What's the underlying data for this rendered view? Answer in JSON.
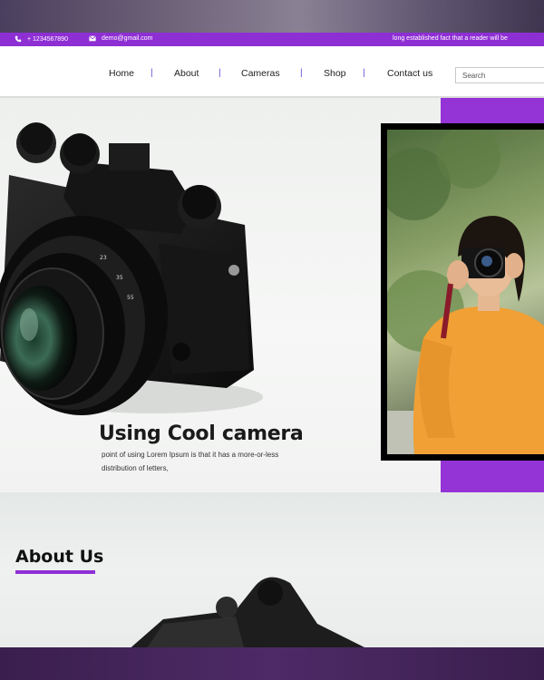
{
  "topbar": {
    "phone": "+ 1234567890",
    "email": "demo@gmail.com",
    "marquee": "long established fact that a reader will be",
    "icons": [
      "phone-icon",
      "mail-icon"
    ],
    "color": "#8e2fd4"
  },
  "nav": {
    "links": [
      "Home",
      "About",
      "Cameras",
      "Shop",
      "Contact us"
    ],
    "separator": "|",
    "search_placeholder": "Search"
  },
  "hero": {
    "title": "Using Cool camera",
    "subtitle": "point of using Lorem Ipsum is that it has a more-or-less distribution of letters,",
    "accent_color": "#9433d6"
  },
  "about": {
    "title": "About Us"
  }
}
